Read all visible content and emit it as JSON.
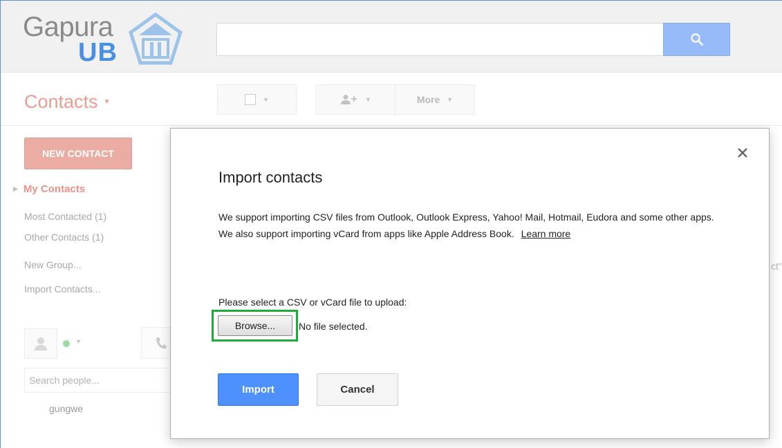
{
  "header": {
    "logo_text": "Gapura",
    "logo_sub": "UB",
    "search": {
      "value": "",
      "placeholder": ""
    }
  },
  "toolbar": {
    "app_title": "Contacts",
    "more_label": "More"
  },
  "sidebar": {
    "new_contact": "NEW CONTACT",
    "my_contacts": "My Contacts",
    "most_contacted": "Most Contacted (1)",
    "other_contacts": "Other Contacts (1)",
    "new_group": "New Group...",
    "import_contacts": "Import Contacts...",
    "search_people_placeholder": "Search people...",
    "chat_user": "gungwe"
  },
  "background": {
    "partial_text": "ct\""
  },
  "modal": {
    "title": "Import contacts",
    "description": "We support importing CSV files from Outlook, Outlook Express, Yahoo! Mail, Hotmail, Eudora and some other apps. We also support importing vCard from apps like Apple Address Book.",
    "learn_more": "Learn more",
    "upload_label": "Please select a CSV or vCard file to upload:",
    "browse_label": "Browse...",
    "file_status": "No file selected.",
    "import_label": "Import",
    "cancel_label": "Cancel"
  },
  "colors": {
    "accent_blue": "#4d90fe",
    "brand_red": "#dd4b39",
    "highlight_green": "#1faa3a"
  },
  "icons": {
    "search": "search-icon",
    "close": "close-icon",
    "add_person": "add-person-icon",
    "avatar": "person-icon",
    "phone": "phone-icon"
  }
}
